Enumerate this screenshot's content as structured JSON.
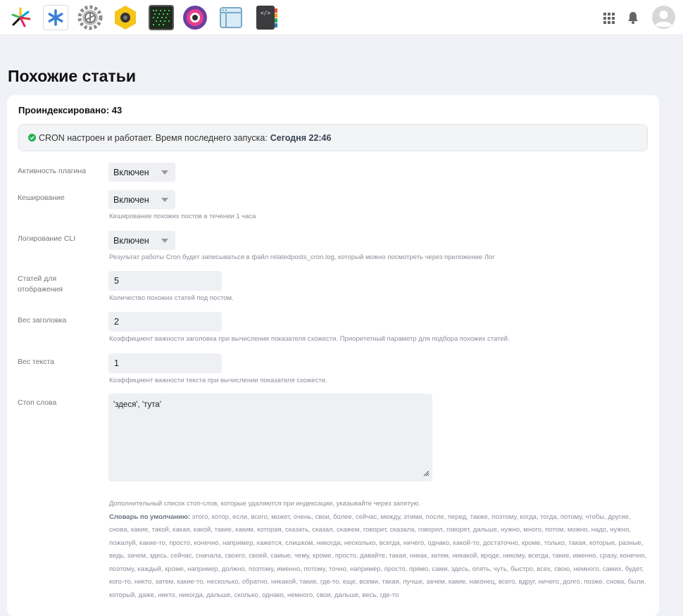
{
  "toolbar": {
    "apps": [
      {
        "icon": "sparkle-app-icon"
      },
      {
        "icon": "asterisk-app-icon"
      },
      {
        "icon": "gear-app-icon"
      },
      {
        "icon": "hexagon-app-icon"
      },
      {
        "icon": "terminal-app-icon"
      },
      {
        "icon": "camera-app-icon"
      },
      {
        "icon": "window-app-icon"
      },
      {
        "icon": "code-app-icon"
      }
    ],
    "right_icons": [
      "grid-icon",
      "bell-icon",
      "avatar-icon"
    ]
  },
  "page": {
    "title": "Похожие статьи",
    "indexed": "Проиндексировано: 43",
    "cron_text": "CRON настроен и работает. Время последнего запуска:",
    "cron_time": "Сегодня 22:46"
  },
  "settings": {
    "plugin_active": {
      "label": "Активность плагина",
      "value": "Включен"
    },
    "caching": {
      "label": "Кеширование",
      "value": "Включен",
      "hint": "Кеширование похожих постов в течении 1 часа"
    },
    "cli_logging": {
      "label": "Логирование CLI",
      "value": "Включен",
      "hint": "Результат работы Cron будет записываться в файл relatedposts_cron.log, который можно посмотреть через приложение Лог"
    },
    "posts_count": {
      "label": "Статей для отображения",
      "value": "5",
      "hint": "Количество похожих статей под постом."
    },
    "title_weight": {
      "label": "Вес заголовка",
      "value": "2",
      "hint": "Коэффициент важности заголовка при вычислении показателя схожести. Приоритетный параметр для подбора похожих статей."
    },
    "text_weight": {
      "label": "Вес текста",
      "value": "1",
      "hint": "Коэффициент важности текста при вычислении показателя схожести."
    },
    "stop_words": {
      "label": "Стоп слова",
      "value": "'здеся', 'тута'",
      "hint": "Дополнительный список стоп-слов, которые удаляются при индексации, указывайте через запятую.",
      "dict_label": "Словарь по умолчанию:",
      "dict_text": "этого, котор, если, всего, может, очень, свои, более, сейчас, между, этими, после, перед, также, поэтому, когда, тогда, потому, чтобы, другие, снова, какие, такой, какая, какой, такие, каким, которая, сказать, сказал, скажем, говорит, сказала, говорил, говорят, дальше, нужно, много, потом, можно, надо, нужно, пожалуй, какие-то, просто, конечно, например, кажется, слишком, никогда, несколько, всегда, ничего, однако, какой-то, достаточно, кроме, только, такая, которые, разные, ведь, зачем, здесь, сейчас, сначала, своего, своей, самые, чему, кроме, просто, давайте, такая, никак, затем, никакой, вроде, никому, всегда, такие, именно, сразу, конечно, поэтому, каждый, кроме, например, должно, поэтому, именно, потому, точно, например, просто, прямо, сами, здесь, опять, чуть, быстро, всех, свою, немного, самих, будет, кого-то, никто, затем, какие-то, несколько, обратно, никакой, такие, где-то, еще, всеми, такая, лучше, зачем, какие, наконец, всего, вдруг, ничего, долго, позже, снова, были, который, даже, никто, никогда, дальше, сколько, однако, немного, свои, дальше, весь, где-то"
    }
  },
  "colors": {
    "ok": "#22b24c",
    "page_bg": "#f1f2f7",
    "field_bg": "#eef0f4"
  }
}
